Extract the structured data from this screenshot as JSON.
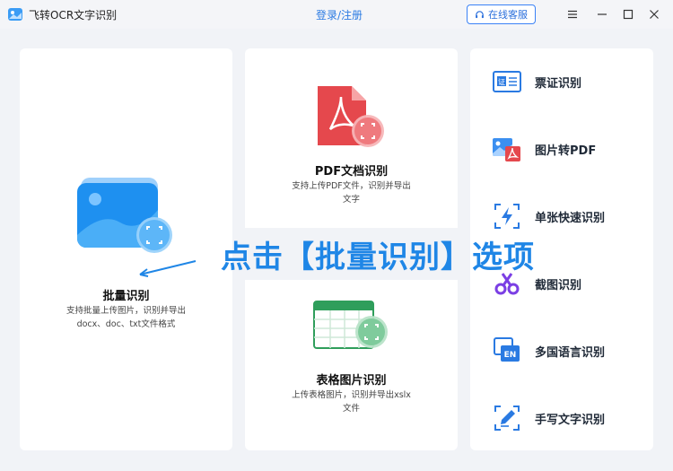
{
  "titlebar": {
    "app_title": "飞转OCR文字识别",
    "login_label": "登录/注册",
    "service_label": "在线客服"
  },
  "features": {
    "batch": {
      "title": "批量识别",
      "desc_line1": "支持批量上传图片，识别并导出",
      "desc_line2": "docx、doc、txt文件格式"
    },
    "pdf": {
      "title": "PDF文档识别",
      "desc_line1": "支持上传PDF文件，识别并导出",
      "desc_line2": "文字"
    },
    "table": {
      "title": "表格图片识别",
      "desc_line1": "上传表格图片，识别并导出xslx",
      "desc_line2": "文件"
    }
  },
  "sidebar": {
    "items": [
      {
        "label": "票证识别",
        "icon": "id-card-icon"
      },
      {
        "label": "图片转PDF",
        "icon": "image-to-pdf-icon"
      },
      {
        "label": "单张快速识别",
        "icon": "lightning-icon"
      },
      {
        "label": "截图识别",
        "icon": "scissors-icon"
      },
      {
        "label": "多国语言识别",
        "icon": "language-icon"
      },
      {
        "label": "手写文字识别",
        "icon": "pen-icon"
      }
    ]
  },
  "overlay": {
    "instruction": "点击【批量识别】选项"
  },
  "colors": {
    "accent": "#2a7ae2",
    "overlay_text": "#1f86e6",
    "pdf_red": "#e5484d",
    "table_green": "#2f9e5b"
  }
}
